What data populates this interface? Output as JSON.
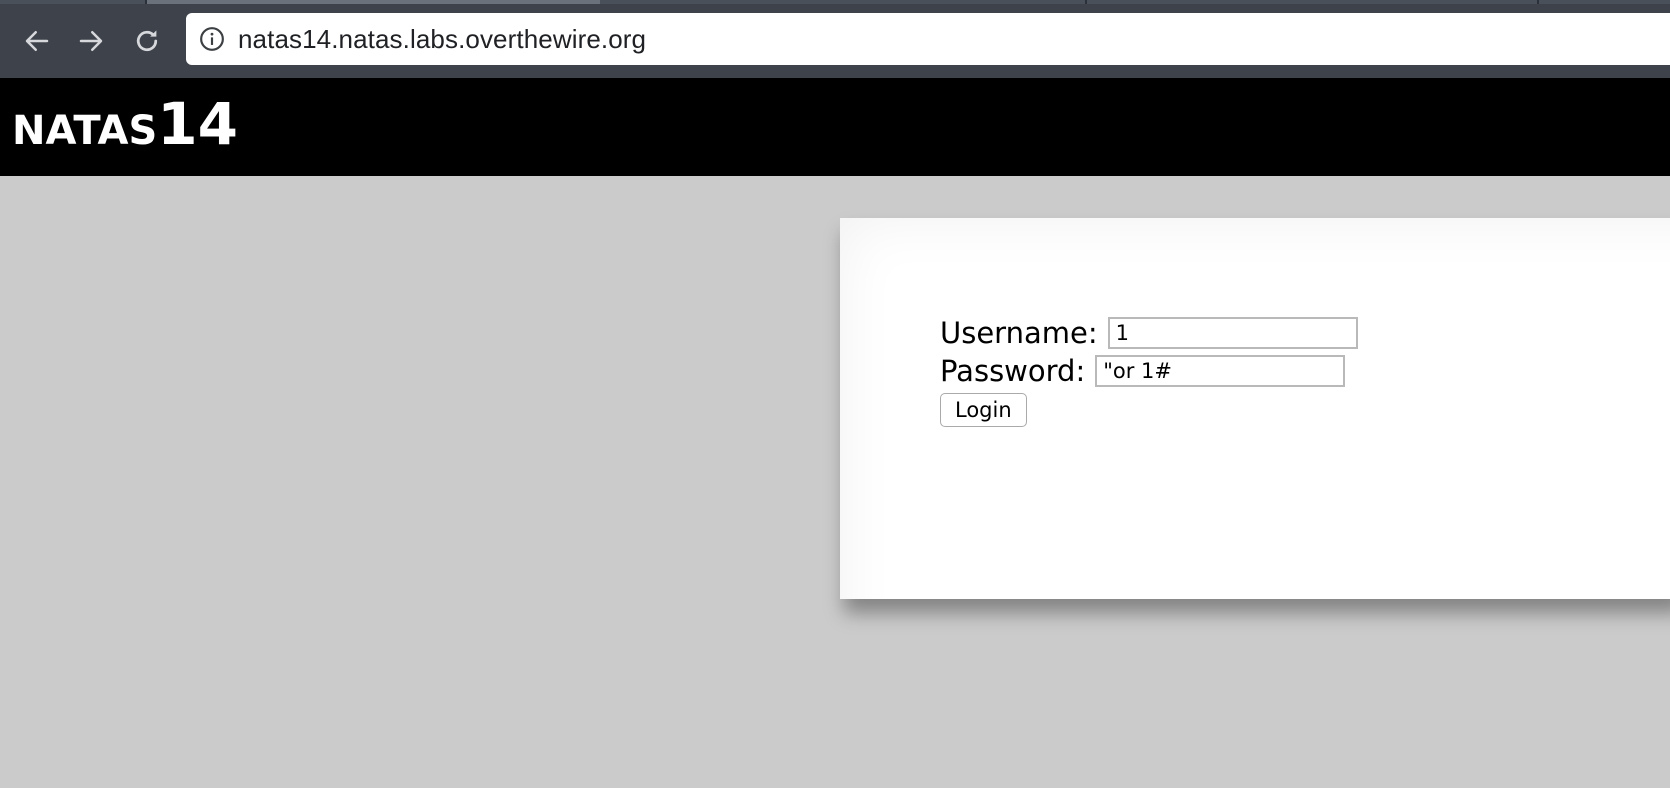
{
  "browser": {
    "url": "natas14.natas.labs.overthewire.org",
    "icons": {
      "back": "arrow-left-icon",
      "forward": "arrow-right-icon",
      "reload": "reload-icon",
      "info": "info-icon"
    }
  },
  "header": {
    "title_word": "NATAS",
    "title_number": "14"
  },
  "form": {
    "username_label": "Username:",
    "username_value": "1",
    "password_label": "Password:",
    "password_value": "\"or 1#",
    "login_label": "Login"
  },
  "colors": {
    "page_background": "#cbcbcb",
    "header_background": "#000000",
    "toolbar_background": "#3d424b",
    "content_background": "#ffffff"
  }
}
